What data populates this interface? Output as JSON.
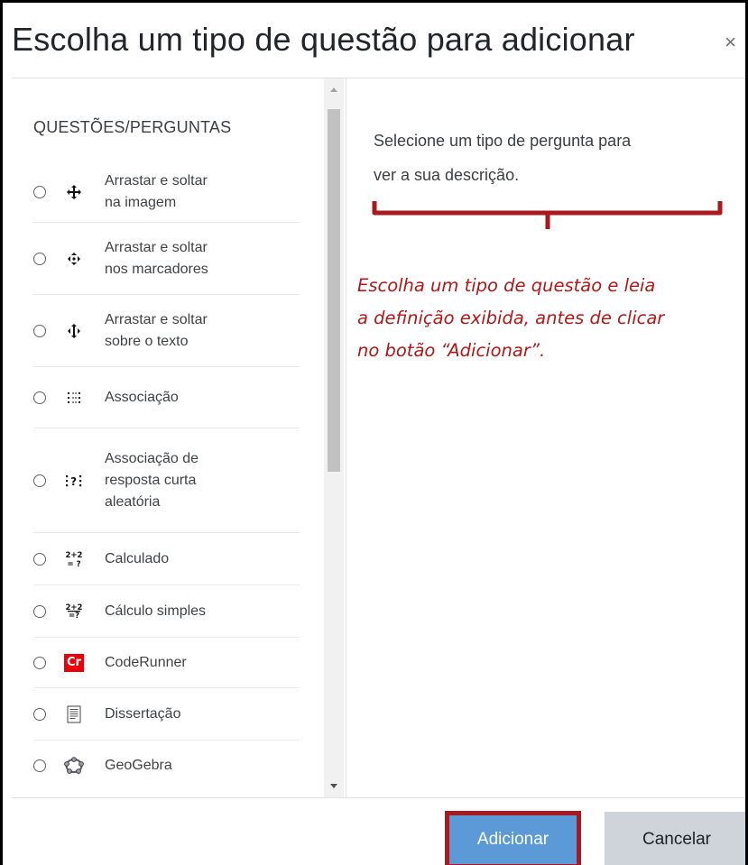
{
  "modal": {
    "title": "Escolha um tipo de questão para adicionar",
    "close_glyph": "×"
  },
  "list": {
    "section_title": "QUESTÕES/PERGUNTAS",
    "options": [
      {
        "icon": "drag-drop-image-icon",
        "label": "Arrastar e soltar na imagem",
        "lines": [
          "Arrastar e soltar",
          "na imagem"
        ]
      },
      {
        "icon": "drag-drop-markers-icon",
        "label": "Arrastar e soltar nos marcadores",
        "lines": [
          "Arrastar e soltar",
          "nos marcadores"
        ]
      },
      {
        "icon": "drag-drop-text-icon",
        "label": "Arrastar e soltar sobre o texto",
        "lines": [
          "Arrastar e soltar",
          "sobre o texto"
        ]
      },
      {
        "icon": "matching-icon",
        "label": "Associação",
        "lines": [
          "Associação"
        ]
      },
      {
        "icon": "random-short-answer-matching-icon",
        "label": "Associação de resposta curta aleatória",
        "lines": [
          "Associação de",
          "resposta curta",
          "aleatória"
        ]
      },
      {
        "icon": "calculated-icon",
        "label": "Calculado",
        "lines": [
          "Calculado"
        ]
      },
      {
        "icon": "calculated-simple-icon",
        "label": "Cálculo simples",
        "lines": [
          "Cálculo simples"
        ]
      },
      {
        "icon": "coderunner-icon",
        "label": "CodeRunner",
        "lines": [
          "CodeRunner"
        ],
        "badge": "Cr"
      },
      {
        "icon": "essay-icon",
        "label": "Dissertação",
        "lines": [
          "Dissertação"
        ]
      },
      {
        "icon": "geogebra-icon",
        "label": "GeoGebra",
        "lines": [
          "GeoGebra"
        ]
      }
    ]
  },
  "description": {
    "line1": "Selecione um tipo de pergunta para",
    "line2": "ver a sua descrição."
  },
  "annotation": {
    "line1": "Escolha um tipo de questão e leia",
    "line2": "a definição exibida, antes de clicar",
    "line3": "no botão “Adicionar”."
  },
  "footer": {
    "add_label": "Adicionar",
    "cancel_label": "Cancelar"
  },
  "colors": {
    "annotation_red": "#b31818",
    "primary_button": "#5b9ad6",
    "highlight_border": "#a9191e",
    "secondary_button": "#ced4da"
  }
}
